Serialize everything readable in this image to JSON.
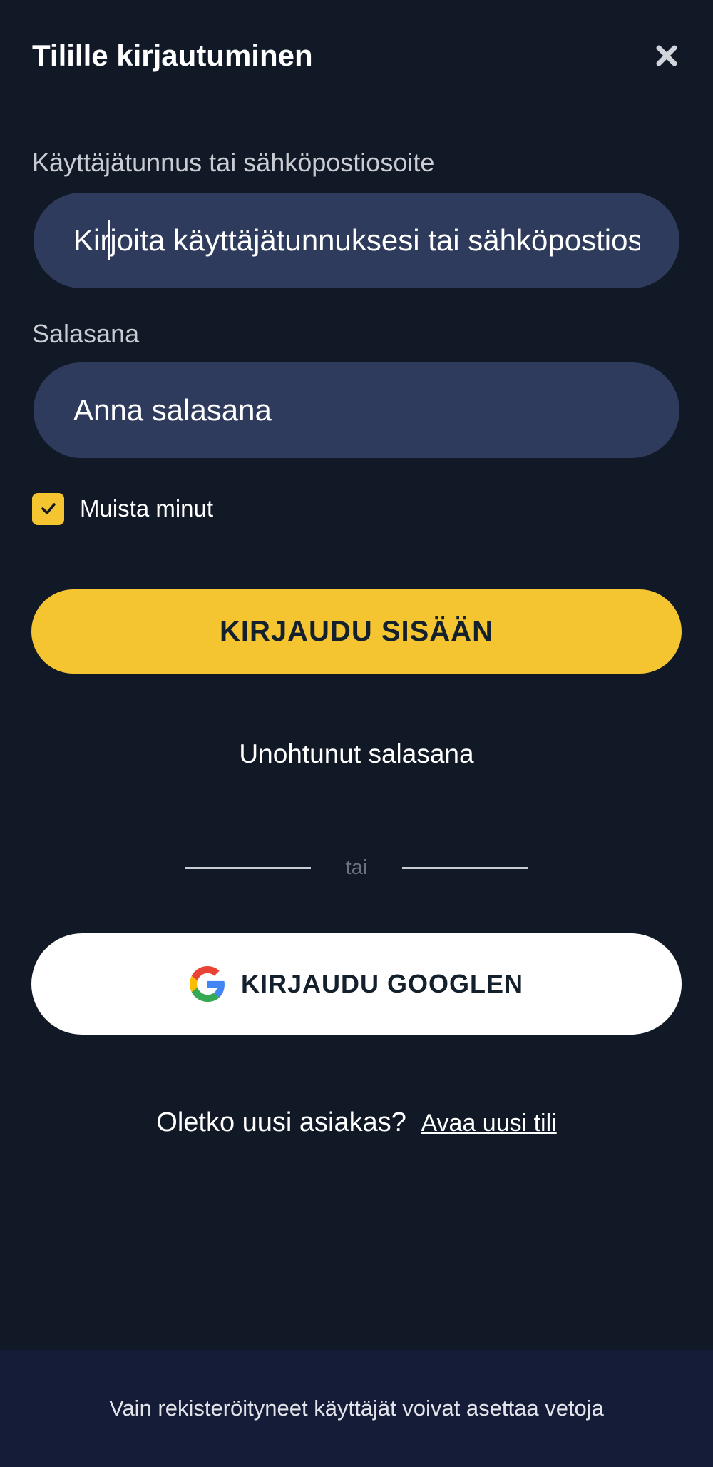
{
  "modal": {
    "title": "Tilille kirjautuminen",
    "close_icon": "close-icon"
  },
  "username": {
    "label": "Käyttäjätunnus tai sähköpostiosoite",
    "placeholder": "Kirjoita käyttäjätunnuksesi tai sähköpostiosoitteesi",
    "value": ""
  },
  "password": {
    "label": "Salasana",
    "placeholder": "Anna salasana",
    "value": ""
  },
  "remember": {
    "label": "Muista minut",
    "checked": true
  },
  "login_button": {
    "label": "KIRJAUDU SISÄÄN"
  },
  "forgot_password": {
    "label": "Unohtunut salasana"
  },
  "divider": {
    "label": "tai"
  },
  "google_button": {
    "label": "KIRJAUDU GOOGLEN",
    "icon": "google-icon"
  },
  "signup": {
    "prompt": "Oletko uusi asiakas?",
    "link": "Avaa uusi tili"
  },
  "footer": {
    "text": "Vain rekisteröityneet käyttäjät voivat asettaa vetoja"
  },
  "colors": {
    "background": "#111927",
    "input_bg": "#2e3b5c",
    "accent": "#f4c431",
    "footer_bg": "#151c37"
  }
}
